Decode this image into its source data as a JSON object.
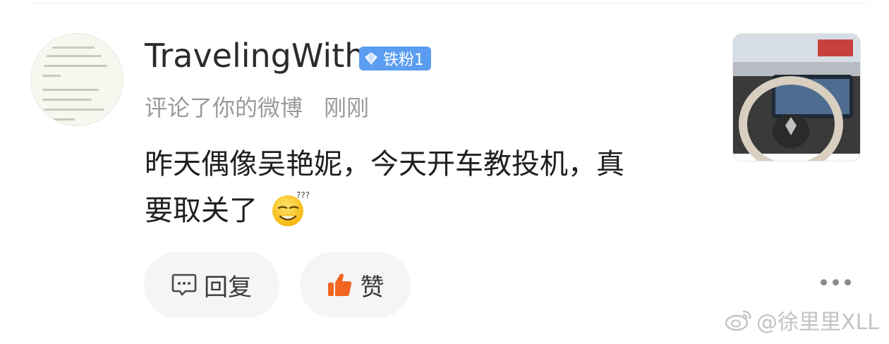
{
  "comment": {
    "username": "TravelingWith",
    "fan_badge": "铁粉1",
    "action_text": "评论了你的微博",
    "time_text": "刚刚",
    "content_line1": "昨天偶像吴艳妮，今天开车教投机，真",
    "content_line2": "要取关了",
    "emoji_name": "sleepy-face-emoji",
    "reply_label": "回复",
    "like_label": "赞"
  },
  "watermark": {
    "text": "@徐里里XLL"
  },
  "colors": {
    "badge": "#5b9df0",
    "like_icon": "#f26522",
    "button_bg": "#f5f5f5",
    "meta_text": "#9a9a9a"
  }
}
